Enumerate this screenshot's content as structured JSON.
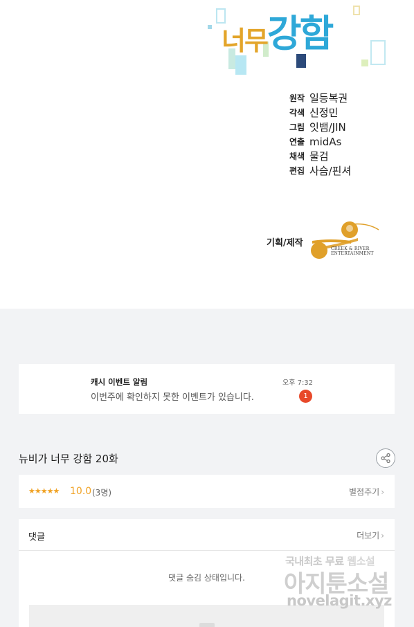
{
  "comic": {
    "title_part1": "너무",
    "title_part2": "강함",
    "credits": [
      {
        "role": "원작",
        "name": "일등복권"
      },
      {
        "role": "각색",
        "name": "신정민"
      },
      {
        "role": "그림",
        "name": "잇뱀/JIN"
      },
      {
        "role": "연출",
        "name": "midAs"
      },
      {
        "role": "채색",
        "name": "물검"
      },
      {
        "role": "편집",
        "name": "사슴/핀셔"
      }
    ],
    "planning_label": "기획/제작",
    "logo_text_line1": "CREEK & RIVER",
    "logo_text_line2": "ENTERTAINMENT"
  },
  "notification": {
    "title": "캐시 이벤트 알림",
    "message": "이번주에 확인하지 못한 이벤트가 있습니다.",
    "time": "오후 7:32",
    "badge": "1"
  },
  "episode": {
    "title": "뉴비가 너무 강함 20화"
  },
  "rating": {
    "stars": "★★★★★",
    "score": "10.0",
    "count": "(3명)",
    "rate_label": "별점주기",
    "chevron": "›"
  },
  "comments": {
    "title": "댓글",
    "more_label": "더보기",
    "chevron": "›",
    "hidden_message": "댓글 숨김 상태입니다."
  },
  "watermark": {
    "line1_a": "국내최초 무료",
    "line1_b": "웹소설",
    "line2": "아지툰소설",
    "line3": "novelagit.xyz"
  },
  "colors": {
    "accent_gold": "#f0a224",
    "badge_red": "#e8492a",
    "title_blue": "#2ea8d8",
    "title_gold": "#e3a52a"
  }
}
